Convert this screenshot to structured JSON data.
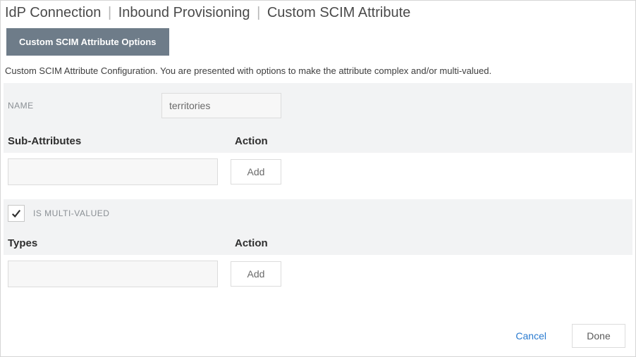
{
  "breadcrumb": {
    "item1": "IdP Connection",
    "item2": "Inbound Provisioning",
    "item3": "Custom SCIM Attribute"
  },
  "optionsButton": "Custom SCIM Attribute Options",
  "description": "Custom SCIM Attribute Configuration. You are presented with options to make the attribute complex and/or multi-valued.",
  "nameLabel": "NAME",
  "nameValue": "territories",
  "subAttrHeader": "Sub-Attributes",
  "actionHeader": "Action",
  "addLabel": "Add",
  "multiValued": {
    "checked": true,
    "label": "IS MULTI-VALUED"
  },
  "typesHeader": "Types",
  "footer": {
    "cancel": "Cancel",
    "done": "Done"
  }
}
